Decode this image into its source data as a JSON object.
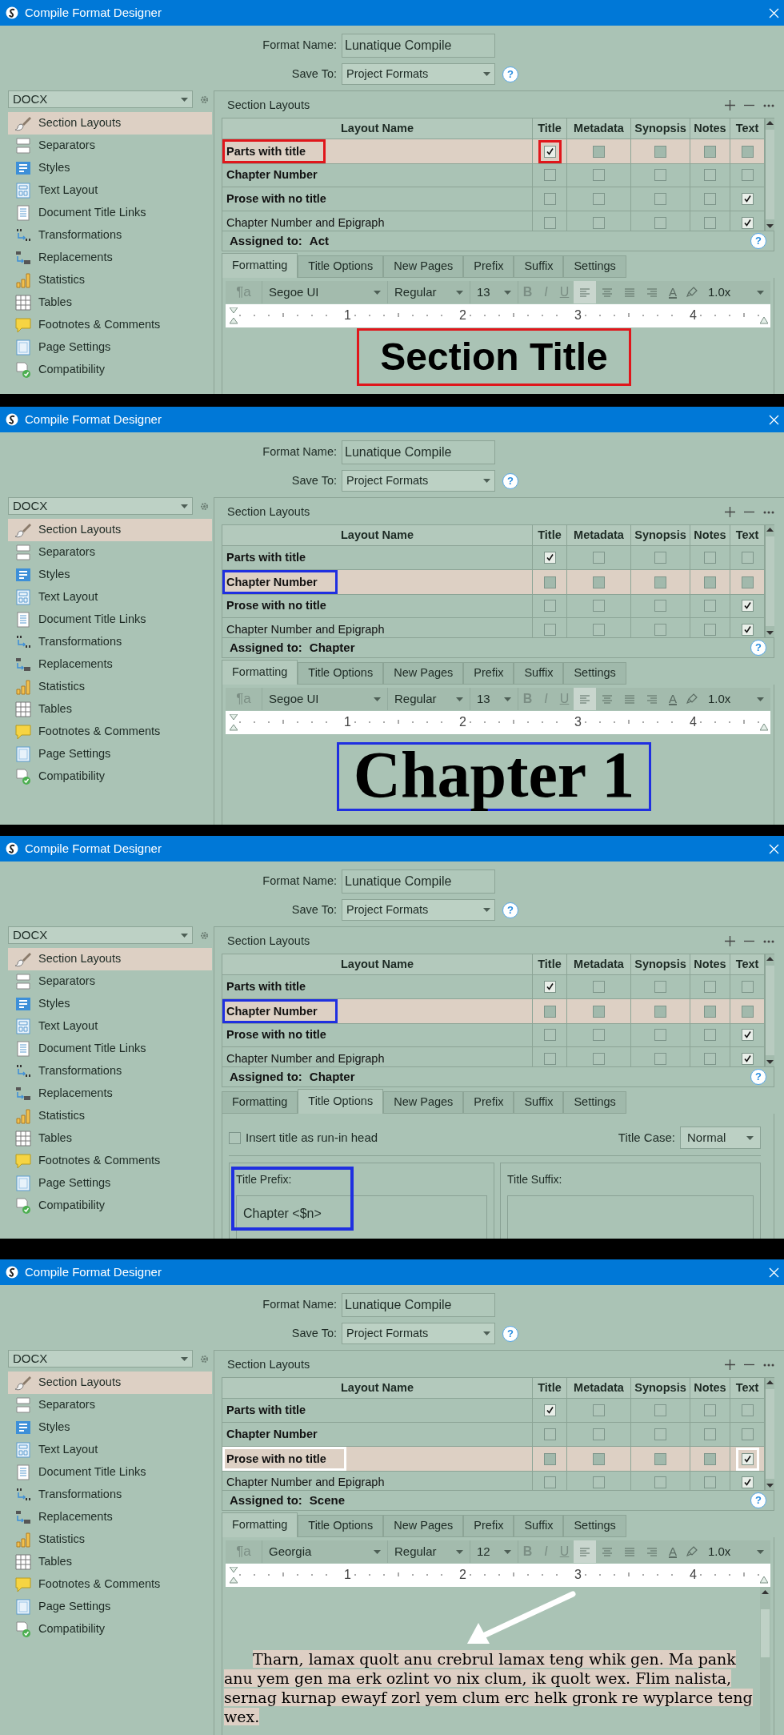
{
  "panels": [
    {
      "window": {
        "title": "Compile Format Designer"
      },
      "format_name": {
        "label": "Format Name:",
        "value": "Lunatique Compile"
      },
      "save_to": {
        "label": "Save To:",
        "value": "Project Formats",
        "help": "?"
      },
      "format_select": {
        "value": "DOCX"
      },
      "sidebar": {
        "items": [
          {
            "label": "Section Layouts",
            "selected": true
          },
          {
            "label": "Separators",
            "selected": false
          },
          {
            "label": "Styles",
            "selected": false
          },
          {
            "label": "Text Layout",
            "selected": false
          },
          {
            "label": "Document Title Links",
            "selected": false
          },
          {
            "label": "Transformations",
            "selected": false
          },
          {
            "label": "Replacements",
            "selected": false
          },
          {
            "label": "Statistics",
            "selected": false
          },
          {
            "label": "Tables",
            "selected": false
          },
          {
            "label": "Footnotes & Comments",
            "selected": false
          },
          {
            "label": "Page Settings",
            "selected": false
          },
          {
            "label": "Compatibility",
            "selected": false
          }
        ]
      },
      "section_layouts": {
        "title": "Section Layouts",
        "columns": [
          "Layout Name",
          "Title",
          "Metadata",
          "Synopsis",
          "Notes",
          "Text"
        ],
        "rows": [
          {
            "name": "Parts with title",
            "bold": true,
            "selected": true,
            "highlight": {
              "color": "#e0161b"
            },
            "cells": [
              {
                "checked": true,
                "highlight": {
                  "color": "#e0161b"
                }
              },
              {
                "checked": false
              },
              {
                "checked": false
              },
              {
                "checked": false
              },
              {
                "checked": false
              }
            ]
          },
          {
            "name": "Chapter Number",
            "bold": true,
            "selected": false,
            "cells": [
              {
                "checked": false
              },
              {
                "checked": false
              },
              {
                "checked": false
              },
              {
                "checked": false
              },
              {
                "checked": false
              }
            ]
          },
          {
            "name": "Prose with no title",
            "bold": true,
            "selected": false,
            "cells": [
              {
                "checked": false
              },
              {
                "checked": false
              },
              {
                "checked": false
              },
              {
                "checked": false
              },
              {
                "checked": true
              }
            ]
          },
          {
            "name": "Chapter Number and Epigraph",
            "bold": false,
            "selected": false,
            "cells": [
              {
                "checked": false
              },
              {
                "checked": false
              },
              {
                "checked": false
              },
              {
                "checked": false
              },
              {
                "checked": true
              }
            ]
          }
        ]
      },
      "assigned": {
        "label": "Assigned to:",
        "value": "Act",
        "help": "?"
      },
      "tabs": [
        {
          "label": "Formatting",
          "selected": true
        },
        {
          "label": "Title Options",
          "selected": false
        },
        {
          "label": "New Pages",
          "selected": false
        },
        {
          "label": "Prefix",
          "selected": false
        },
        {
          "label": "Suffix",
          "selected": false
        },
        {
          "label": "Settings",
          "selected": false
        }
      ],
      "content": {
        "kind": "formatting",
        "toolbar": {
          "style_button": "¶a",
          "font": "Segoe UI",
          "weight": "Regular",
          "size": "13",
          "format_buttons": [
            "B",
            "I",
            "U"
          ],
          "alignments": [
            {
              "kind": "left",
              "selected": true
            },
            {
              "kind": "center",
              "selected": false
            },
            {
              "kind": "justify",
              "selected": false
            },
            {
              "kind": "right",
              "selected": false
            }
          ],
          "text_color_button": "A",
          "line_spacing": "1.0x"
        },
        "ruler": {
          "numbers": [
            "1",
            "2",
            "3",
            "4"
          ]
        },
        "preview": {
          "kind": "sans_heading",
          "text": "Section Title",
          "highlight": {
            "color": "#e0161b"
          }
        }
      }
    },
    {
      "window": {
        "title": "Compile Format Designer"
      },
      "format_name": {
        "label": "Format Name:",
        "value": "Lunatique Compile"
      },
      "save_to": {
        "label": "Save To:",
        "value": "Project Formats",
        "help": "?"
      },
      "format_select": {
        "value": "DOCX"
      },
      "sidebar": {
        "items": [
          {
            "label": "Section Layouts",
            "selected": true
          },
          {
            "label": "Separators",
            "selected": false
          },
          {
            "label": "Styles",
            "selected": false
          },
          {
            "label": "Text Layout",
            "selected": false
          },
          {
            "label": "Document Title Links",
            "selected": false
          },
          {
            "label": "Transformations",
            "selected": false
          },
          {
            "label": "Replacements",
            "selected": false
          },
          {
            "label": "Statistics",
            "selected": false
          },
          {
            "label": "Tables",
            "selected": false
          },
          {
            "label": "Footnotes & Comments",
            "selected": false
          },
          {
            "label": "Page Settings",
            "selected": false
          },
          {
            "label": "Compatibility",
            "selected": false
          }
        ]
      },
      "section_layouts": {
        "title": "Section Layouts",
        "columns": [
          "Layout Name",
          "Title",
          "Metadata",
          "Synopsis",
          "Notes",
          "Text"
        ],
        "rows": [
          {
            "name": "Parts with title",
            "bold": true,
            "selected": false,
            "cells": [
              {
                "checked": true
              },
              {
                "checked": false
              },
              {
                "checked": false
              },
              {
                "checked": false
              },
              {
                "checked": false
              }
            ]
          },
          {
            "name": "Chapter Number",
            "bold": true,
            "selected": true,
            "highlight": {
              "color": "#1f2fe0"
            },
            "cells": [
              {
                "checked": false
              },
              {
                "checked": false
              },
              {
                "checked": false
              },
              {
                "checked": false
              },
              {
                "checked": false
              }
            ]
          },
          {
            "name": "Prose with no title",
            "bold": true,
            "selected": false,
            "cells": [
              {
                "checked": false
              },
              {
                "checked": false
              },
              {
                "checked": false
              },
              {
                "checked": false
              },
              {
                "checked": true
              }
            ]
          },
          {
            "name": "Chapter Number and Epigraph",
            "bold": false,
            "selected": false,
            "cells": [
              {
                "checked": false
              },
              {
                "checked": false
              },
              {
                "checked": false
              },
              {
                "checked": false
              },
              {
                "checked": true
              }
            ]
          }
        ]
      },
      "assigned": {
        "label": "Assigned to:",
        "value": "Chapter",
        "help": "?"
      },
      "tabs": [
        {
          "label": "Formatting",
          "selected": true
        },
        {
          "label": "Title Options",
          "selected": false
        },
        {
          "label": "New Pages",
          "selected": false
        },
        {
          "label": "Prefix",
          "selected": false
        },
        {
          "label": "Suffix",
          "selected": false
        },
        {
          "label": "Settings",
          "selected": false
        }
      ],
      "content": {
        "kind": "formatting",
        "toolbar": {
          "style_button": "¶a",
          "font": "Segoe UI",
          "weight": "Regular",
          "size": "13",
          "format_buttons": [
            "B",
            "I",
            "U"
          ],
          "alignments": [
            {
              "kind": "left",
              "selected": true
            },
            {
              "kind": "center",
              "selected": false
            },
            {
              "kind": "justify",
              "selected": false
            },
            {
              "kind": "right",
              "selected": false
            }
          ],
          "text_color_button": "A",
          "line_spacing": "1.0x"
        },
        "ruler": {
          "numbers": [
            "1",
            "2",
            "3",
            "4"
          ]
        },
        "preview": {
          "kind": "serif_heading",
          "text": "Chapter 1",
          "highlight": {
            "color": "#1f2fe0"
          }
        }
      }
    },
    {
      "window": {
        "title": "Compile Format Designer"
      },
      "format_name": {
        "label": "Format Name:",
        "value": "Lunatique Compile"
      },
      "save_to": {
        "label": "Save To:",
        "value": "Project Formats",
        "help": "?"
      },
      "format_select": {
        "value": "DOCX"
      },
      "sidebar": {
        "items": [
          {
            "label": "Section Layouts",
            "selected": true
          },
          {
            "label": "Separators",
            "selected": false
          },
          {
            "label": "Styles",
            "selected": false
          },
          {
            "label": "Text Layout",
            "selected": false
          },
          {
            "label": "Document Title Links",
            "selected": false
          },
          {
            "label": "Transformations",
            "selected": false
          },
          {
            "label": "Replacements",
            "selected": false
          },
          {
            "label": "Statistics",
            "selected": false
          },
          {
            "label": "Tables",
            "selected": false
          },
          {
            "label": "Footnotes & Comments",
            "selected": false
          },
          {
            "label": "Page Settings",
            "selected": false
          },
          {
            "label": "Compatibility",
            "selected": false
          }
        ]
      },
      "section_layouts": {
        "title": "Section Layouts",
        "columns": [
          "Layout Name",
          "Title",
          "Metadata",
          "Synopsis",
          "Notes",
          "Text"
        ],
        "rows": [
          {
            "name": "Parts with title",
            "bold": true,
            "selected": false,
            "cells": [
              {
                "checked": true
              },
              {
                "checked": false
              },
              {
                "checked": false
              },
              {
                "checked": false
              },
              {
                "checked": false
              }
            ]
          },
          {
            "name": "Chapter Number",
            "bold": true,
            "selected": true,
            "highlight": {
              "color": "#1f2fe0"
            },
            "cells": [
              {
                "checked": false
              },
              {
                "checked": false
              },
              {
                "checked": false
              },
              {
                "checked": false
              },
              {
                "checked": false
              }
            ]
          },
          {
            "name": "Prose with no title",
            "bold": true,
            "selected": false,
            "cells": [
              {
                "checked": false
              },
              {
                "checked": false
              },
              {
                "checked": false
              },
              {
                "checked": false
              },
              {
                "checked": true
              }
            ]
          },
          {
            "name": "Chapter Number and Epigraph",
            "bold": false,
            "selected": false,
            "cells": [
              {
                "checked": false
              },
              {
                "checked": false
              },
              {
                "checked": false
              },
              {
                "checked": false
              },
              {
                "checked": true
              }
            ]
          }
        ]
      },
      "assigned": {
        "label": "Assigned to:",
        "value": "Chapter",
        "help": "?"
      },
      "tabs": [
        {
          "label": "Formatting",
          "selected": false
        },
        {
          "label": "Title Options",
          "selected": true
        },
        {
          "label": "New Pages",
          "selected": false
        },
        {
          "label": "Prefix",
          "selected": false
        },
        {
          "label": "Suffix",
          "selected": false
        },
        {
          "label": "Settings",
          "selected": false
        }
      ],
      "content": {
        "kind": "title_options",
        "run_in": {
          "label": "Insert title as run-in head",
          "checked": false
        },
        "title_case": {
          "label": "Title Case:",
          "value": "Normal"
        },
        "prefix": {
          "label": "Title Prefix:",
          "value": "Chapter <$n>",
          "highlight": {
            "color": "#1f2fe0"
          }
        },
        "suffix": {
          "label": "Title Suffix:"
        }
      }
    },
    {
      "window": {
        "title": "Compile Format Designer"
      },
      "format_name": {
        "label": "Format Name:",
        "value": "Lunatique Compile"
      },
      "save_to": {
        "label": "Save To:",
        "value": "Project Formats",
        "help": "?"
      },
      "format_select": {
        "value": "DOCX"
      },
      "sidebar": {
        "items": [
          {
            "label": "Section Layouts",
            "selected": true
          },
          {
            "label": "Separators",
            "selected": false
          },
          {
            "label": "Styles",
            "selected": false
          },
          {
            "label": "Text Layout",
            "selected": false
          },
          {
            "label": "Document Title Links",
            "selected": false
          },
          {
            "label": "Transformations",
            "selected": false
          },
          {
            "label": "Replacements",
            "selected": false
          },
          {
            "label": "Statistics",
            "selected": false
          },
          {
            "label": "Tables",
            "selected": false
          },
          {
            "label": "Footnotes & Comments",
            "selected": false
          },
          {
            "label": "Page Settings",
            "selected": false
          },
          {
            "label": "Compatibility",
            "selected": false
          }
        ]
      },
      "section_layouts": {
        "title": "Section Layouts",
        "columns": [
          "Layout Name",
          "Title",
          "Metadata",
          "Synopsis",
          "Notes",
          "Text"
        ],
        "rows": [
          {
            "name": "Parts with title",
            "bold": true,
            "selected": false,
            "cells": [
              {
                "checked": true
              },
              {
                "checked": false
              },
              {
                "checked": false
              },
              {
                "checked": false
              },
              {
                "checked": false
              }
            ]
          },
          {
            "name": "Chapter Number",
            "bold": true,
            "selected": false,
            "cells": [
              {
                "checked": false
              },
              {
                "checked": false
              },
              {
                "checked": false
              },
              {
                "checked": false
              },
              {
                "checked": false
              }
            ]
          },
          {
            "name": "Prose with no title",
            "bold": true,
            "selected": true,
            "highlight": {
              "color": "#ffffff"
            },
            "cells": [
              {
                "checked": false
              },
              {
                "checked": false
              },
              {
                "checked": false
              },
              {
                "checked": false
              },
              {
                "checked": true,
                "highlight": {
                  "color": "#ffffff"
                }
              }
            ]
          },
          {
            "name": "Chapter Number and Epigraph",
            "bold": false,
            "selected": false,
            "cells": [
              {
                "checked": false
              },
              {
                "checked": false
              },
              {
                "checked": false
              },
              {
                "checked": false
              },
              {
                "checked": true
              }
            ]
          }
        ]
      },
      "assigned": {
        "label": "Assigned to:",
        "value": "Scene",
        "help": "?"
      },
      "tabs": [
        {
          "label": "Formatting",
          "selected": true
        },
        {
          "label": "Title Options",
          "selected": false
        },
        {
          "label": "New Pages",
          "selected": false
        },
        {
          "label": "Prefix",
          "selected": false
        },
        {
          "label": "Suffix",
          "selected": false
        },
        {
          "label": "Settings",
          "selected": false
        }
      ],
      "content": {
        "kind": "formatting",
        "toolbar": {
          "style_button": "¶a",
          "font": "Georgia",
          "weight": "Regular",
          "size": "12",
          "format_buttons": [
            "B",
            "I",
            "U"
          ],
          "alignments": [
            {
              "kind": "left",
              "selected": true
            },
            {
              "kind": "center",
              "selected": false
            },
            {
              "kind": "justify",
              "selected": false
            },
            {
              "kind": "right",
              "selected": false
            }
          ],
          "text_color_button": "A",
          "line_spacing": "1.0x"
        },
        "ruler": {
          "numbers": [
            "1",
            "2",
            "3",
            "4"
          ]
        },
        "preview": {
          "kind": "body",
          "text": "Tharn, lamax quolt anu crebrul lamax teng whik gen. Ma pank anu yem gen ma erk ozlint vo nix clum, ik quolt wex. Flim nalista, sernag kurnap ewayf zorl yem clum erc helk gronk re wyplarce teng wex."
        }
      }
    }
  ]
}
